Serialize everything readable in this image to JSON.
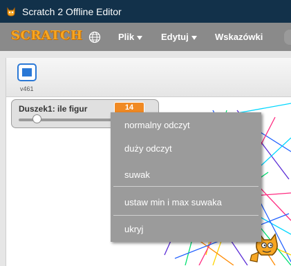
{
  "window": {
    "title": "Scratch 2 Offline Editor",
    "icon": "scratch-cat-icon"
  },
  "menubar": {
    "logo": "SCRATCH",
    "language_icon": "globe-icon",
    "items": [
      {
        "label": "Plik",
        "has_arrow": true
      },
      {
        "label": "Edytuj",
        "has_arrow": true
      },
      {
        "label": "Wskazówki",
        "has_arrow": false
      }
    ]
  },
  "stage": {
    "fullscreen_icon": "fullscreen-icon",
    "version": "v461",
    "monitor": {
      "label": "Duszek1: ile figur",
      "value": "14",
      "slider_fraction": 0.14
    },
    "line_colors": [
      "#00d7ff",
      "#5a2bd6",
      "#ffd400",
      "#ff2a80",
      "#00e070",
      "#2060ff",
      "#ff8a00"
    ]
  },
  "context_menu": {
    "items": [
      "normalny odczyt",
      "duży odczyt",
      "suwak",
      "ustaw min i max suwaka",
      "ukryj"
    ]
  },
  "colors": {
    "titlebar": "#12314a",
    "menubar": "#8a8a8a",
    "context_menu": "#9b9b9b",
    "monitor_value": "#f08a24",
    "accent_blue": "#2a78d6"
  }
}
